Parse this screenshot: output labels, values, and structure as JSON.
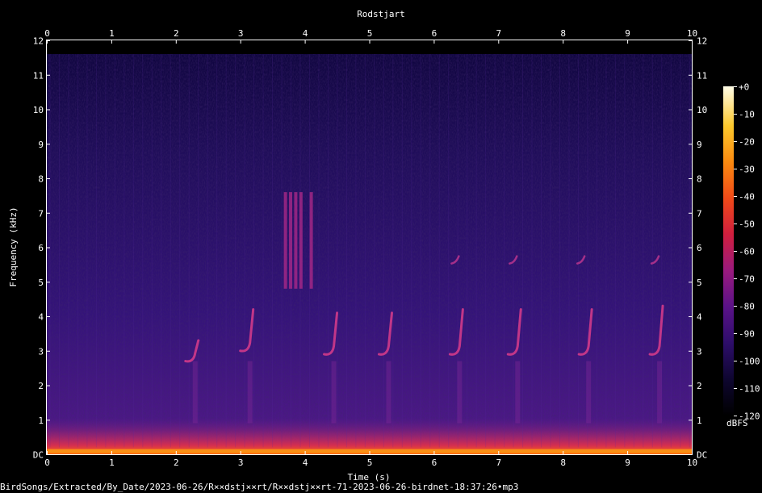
{
  "chart_data": {
    "type": "heatmap",
    "title": "Rodstjart",
    "xlabel": "Time (s)",
    "ylabel": "Frequency (kHz)",
    "xlim": [
      0,
      10
    ],
    "ylim": [
      0,
      12
    ],
    "x_ticks": [
      "0",
      "1",
      "2",
      "3",
      "4",
      "5",
      "6",
      "7",
      "8",
      "9",
      "10"
    ],
    "y_ticks": [
      "DC",
      "1",
      "2",
      "3",
      "4",
      "5",
      "6",
      "7",
      "8",
      "9",
      "10",
      "11",
      "12"
    ],
    "colorbar": {
      "label": "dBFS",
      "ticks": [
        "+0",
        "-10",
        "-20",
        "-30",
        "-40",
        "-50",
        "-60",
        "-70",
        "-80",
        "-90",
        "-100",
        "-110",
        "-120"
      ],
      "range": [
        -120,
        0
      ],
      "colormap": [
        "#000000",
        "#1a0640",
        "#3b0f70",
        "#6a1b8a",
        "#a3237a",
        "#d8304a",
        "#f3601a",
        "#fb9a12",
        "#fcd53a",
        "#fffde0"
      ]
    },
    "calls": [
      {
        "t": 2.3,
        "f_low": 2.7,
        "f_high": 3.3
      },
      {
        "t": 3.15,
        "f_low": 3.0,
        "f_high": 4.2
      },
      {
        "t": 4.45,
        "f_low": 2.9,
        "f_high": 4.1
      },
      {
        "t": 5.3,
        "f_low": 2.9,
        "f_high": 4.1
      },
      {
        "t": 6.4,
        "f_low": 2.9,
        "f_high": 4.2
      },
      {
        "t": 7.3,
        "f_low": 2.9,
        "f_high": 4.2
      },
      {
        "t": 8.4,
        "f_low": 2.9,
        "f_high": 4.2
      },
      {
        "t": 9.5,
        "f_low": 2.9,
        "f_high": 4.3
      }
    ],
    "high_calls": [
      {
        "t": 6.35,
        "f": 5.6
      },
      {
        "t": 7.25,
        "f": 5.6
      },
      {
        "t": 8.3,
        "f": 5.6
      },
      {
        "t": 9.45,
        "f": 5.6
      }
    ],
    "wideband_streaks": [
      {
        "t": 3.7,
        "f_low": 4.8,
        "f_high": 7.6
      },
      {
        "t": 3.78,
        "f_low": 4.8,
        "f_high": 7.6
      },
      {
        "t": 3.86,
        "f_low": 4.8,
        "f_high": 7.6
      },
      {
        "t": 3.94,
        "f_low": 4.8,
        "f_high": 7.6
      },
      {
        "t": 4.1,
        "f_low": 4.8,
        "f_high": 7.6
      }
    ]
  },
  "caption": "BirdSongs/Extracted/By_Date/2023-06-26/R××dstj××rt/R××dstj××rt-71-2023-06-26-birdnet-18:37:26•mp3"
}
